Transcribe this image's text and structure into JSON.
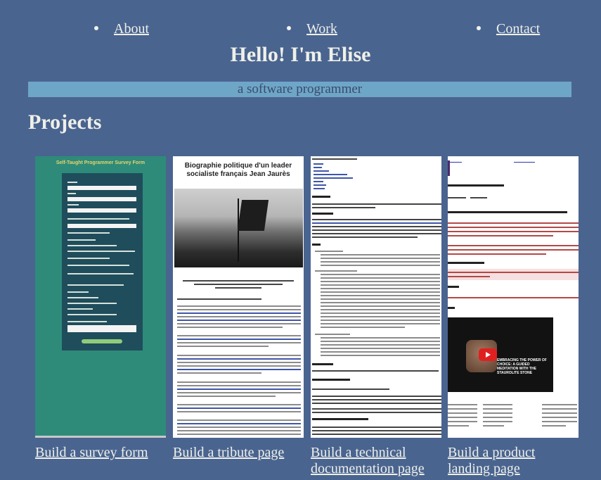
{
  "nav": {
    "items": [
      {
        "label": "About"
      },
      {
        "label": "Work"
      },
      {
        "label": "Contact"
      }
    ]
  },
  "hero": {
    "title": "Hello! I'm Elise",
    "tagline": "a software programmer"
  },
  "projects": {
    "heading": "Projects",
    "items": [
      {
        "label": "Build a survey form",
        "thumb_title": "Self-Taught Programmer Survey Form"
      },
      {
        "label": "Build a tribute page",
        "thumb_title": "Biographie politique d'un leader socialiste français Jean Jaurès"
      },
      {
        "label": "Build a technical documentation page"
      },
      {
        "label": "Build a product landing page",
        "thumb_video_text": "EMBRACING THE POWER OF CHOICE: A GUIDED MEDITATION WITH THE STAUROLITE STONE"
      }
    ]
  },
  "colors": {
    "background": "#4a6490",
    "tagline_bg": "#6ea6c8",
    "text": "#eef0e8"
  }
}
